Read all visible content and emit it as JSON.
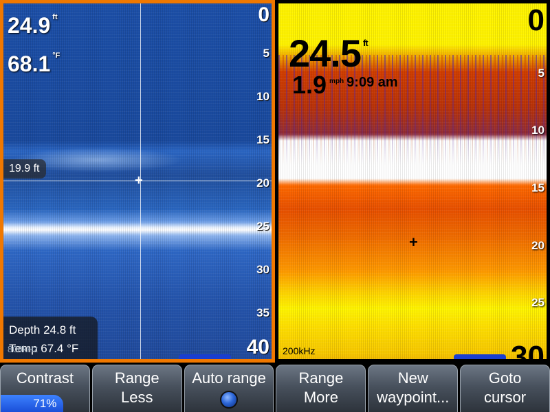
{
  "left_pane": {
    "depth_value": "24.9",
    "depth_unit": "ft",
    "temp_value": "68.1",
    "temp_unit": "°F",
    "scale": [
      "0",
      "5",
      "10",
      "15",
      "20",
      "25",
      "30",
      "35",
      "40"
    ],
    "cursor_depth": "19.9 ft",
    "info_depth": "Depth 24.8  ft",
    "info_temp": "Temp  67.4 °F",
    "frequency": "800kHz",
    "border_color": "#f07800"
  },
  "right_pane": {
    "depth_value": "24.5",
    "depth_unit": "ft",
    "speed_value": "1.9",
    "speed_unit": "mph",
    "time": "9:09 am",
    "scale": [
      "0",
      "5",
      "10",
      "15",
      "20",
      "25",
      "30"
    ],
    "frequency": "200kHz"
  },
  "softkeys": {
    "contrast": {
      "label": "Contrast",
      "percent_text": "71%",
      "level": 0.71
    },
    "range_less": {
      "line1": "Range",
      "line2": "Less"
    },
    "auto_range": {
      "label": "Auto range",
      "indicator_icon": "led-indicator-icon"
    },
    "range_more": {
      "line1": "Range",
      "line2": "More"
    },
    "new_waypoint": {
      "line1": "New",
      "line2": "waypoint..."
    },
    "goto_cursor": {
      "line1": "Goto",
      "line2": "cursor"
    }
  },
  "colors": {
    "active_pane_border": "#f07800",
    "contrast_bar": "#2a63e8"
  }
}
